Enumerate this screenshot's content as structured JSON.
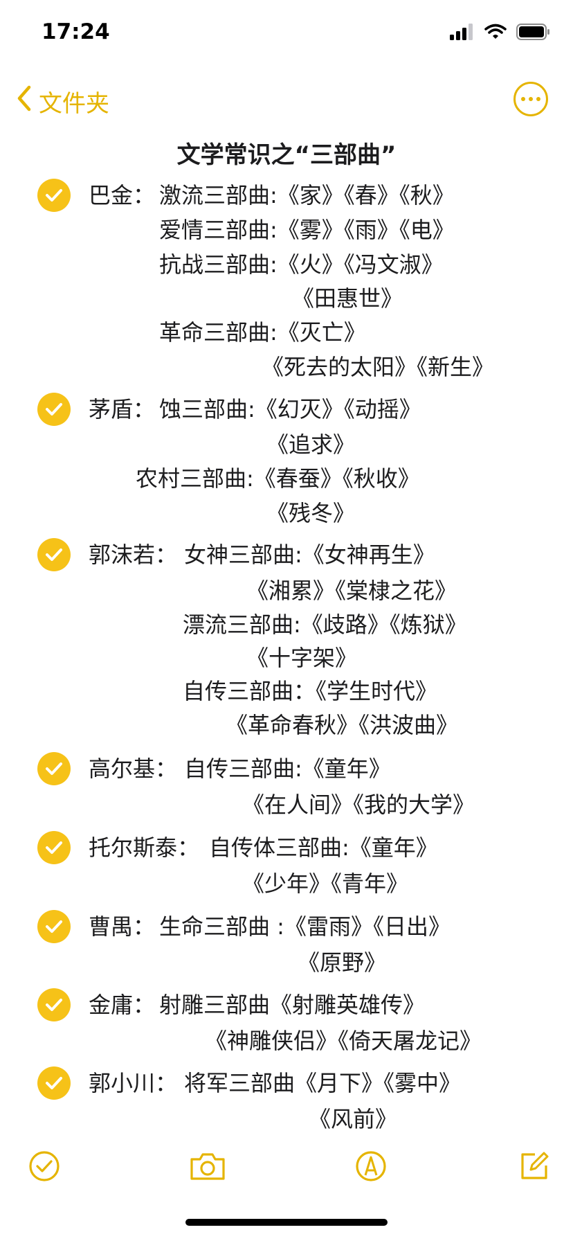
{
  "status": {
    "time": "17:24"
  },
  "nav": {
    "back_label": "文件夹"
  },
  "note": {
    "title": "文学常识之“三部曲”",
    "items": [
      {
        "author": "巴金：",
        "lines": [
          "激流三部曲:《家》《春》《秋》",
          "爱情三部曲:《雾》《雨》《电》",
          "抗战三部曲:《火》《冯文淑》",
          "《田惠世》",
          "革命三部曲:《灭亡》",
          "《死去的太阳》《新生》"
        ]
      },
      {
        "author": "茅盾：",
        "lines": [
          "蚀三部曲:《幻灭》《动摇》",
          "《追求》",
          "农村三部曲:《春蚕》《秋收》",
          "《残冬》"
        ]
      },
      {
        "author": "郭沫若：",
        "lines": [
          "女神三部曲:《女神再生》",
          "《湘累》《棠棣之花》",
          "漂流三部曲:《歧路》《炼狱》",
          "《十字架》",
          "自传三部曲：《学生时代》",
          "《革命春秋》《洪波曲》"
        ]
      },
      {
        "author": "高尔基：",
        "lines": [
          "自传三部曲:《童年》",
          "《在人间》《我的大学》"
        ]
      },
      {
        "author": "托尔斯泰：",
        "lines": [
          "自传体三部曲:《童年》",
          "《少年》《青年》"
        ]
      },
      {
        "author": "曹禺：",
        "lines": [
          "生命三部曲 :《雷雨》《日出》",
          "《原野》"
        ]
      },
      {
        "author": "金庸：",
        "lines": [
          "射雕三部曲《射雕英雄传》",
          "《神雕侠侣》《倚天屠龙记》"
        ]
      },
      {
        "author": "郭小川：",
        "lines": [
          "将军三部曲《月下》《雾中》",
          "《风前》"
        ]
      }
    ]
  },
  "toolbar": {
    "icons": [
      "checklist-icon",
      "camera-icon",
      "markup-icon",
      "compose-icon"
    ]
  },
  "colors": {
    "accent": "#e5b400",
    "check": "#f6c218"
  }
}
